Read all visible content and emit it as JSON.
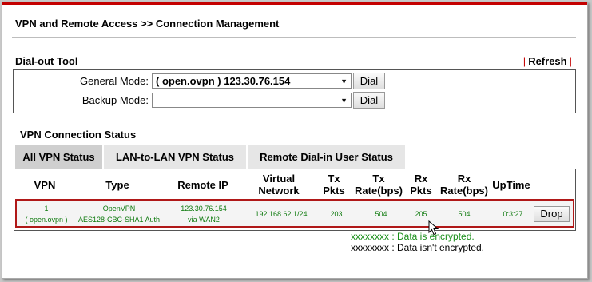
{
  "page": {
    "title": "VPN and Remote Access >> Connection Management"
  },
  "dialout": {
    "title": "Dial-out Tool",
    "refresh_label": "Refresh",
    "general_mode_label": "General Mode:",
    "general_mode_value": "( open.ovpn ) 123.30.76.154",
    "backup_mode_label": "Backup Mode:",
    "backup_mode_value": "",
    "dial_label": "Dial"
  },
  "status": {
    "title": "VPN Connection Status",
    "tabs": [
      {
        "label": "All VPN Status",
        "active": true
      },
      {
        "label": "LAN-to-LAN VPN Status",
        "active": false
      },
      {
        "label": "Remote Dial-in User Status",
        "active": false
      }
    ],
    "columns": {
      "vpn": "VPN",
      "type": "Type",
      "remote_ip": "Remote IP",
      "virtual_network_1": "Virtual",
      "virtual_network_2": "Network",
      "tx_pkts_1": "Tx",
      "tx_pkts_2": "Pkts",
      "tx_rate_1": "Tx",
      "tx_rate_2": "Rate(bps)",
      "rx_pkts_1": "Rx",
      "rx_pkts_2": "Pkts",
      "rx_rate_1": "Rx",
      "rx_rate_2": "Rate(bps)",
      "uptime": "UpTime"
    },
    "rows": [
      {
        "vpn_index": "1",
        "vpn_name": "( open.ovpn )",
        "type_1": "OpenVPN",
        "type_2": "AES128-CBC-SHA1 Auth",
        "remote_ip_1": "123.30.76.154",
        "remote_ip_2": "via WAN2",
        "virtual_network": "192.168.62.1/24",
        "tx_pkts": "203",
        "tx_rate": "504",
        "rx_pkts": "205",
        "rx_rate": "504",
        "uptime": "0:3:27",
        "drop_label": "Drop"
      }
    ],
    "legend": {
      "encrypted": "xxxxxxxx : Data is encrypted.",
      "unencrypted": "xxxxxxxx : Data isn't encrypted."
    }
  },
  "colors": {
    "accent_red": "#c40000",
    "encrypted_green": "#0e7a0e",
    "active_tab": "#cfcfcf",
    "inactive_tab": "#e6e6e6"
  },
  "icons": {
    "cursor": "mouse-pointer-icon"
  }
}
